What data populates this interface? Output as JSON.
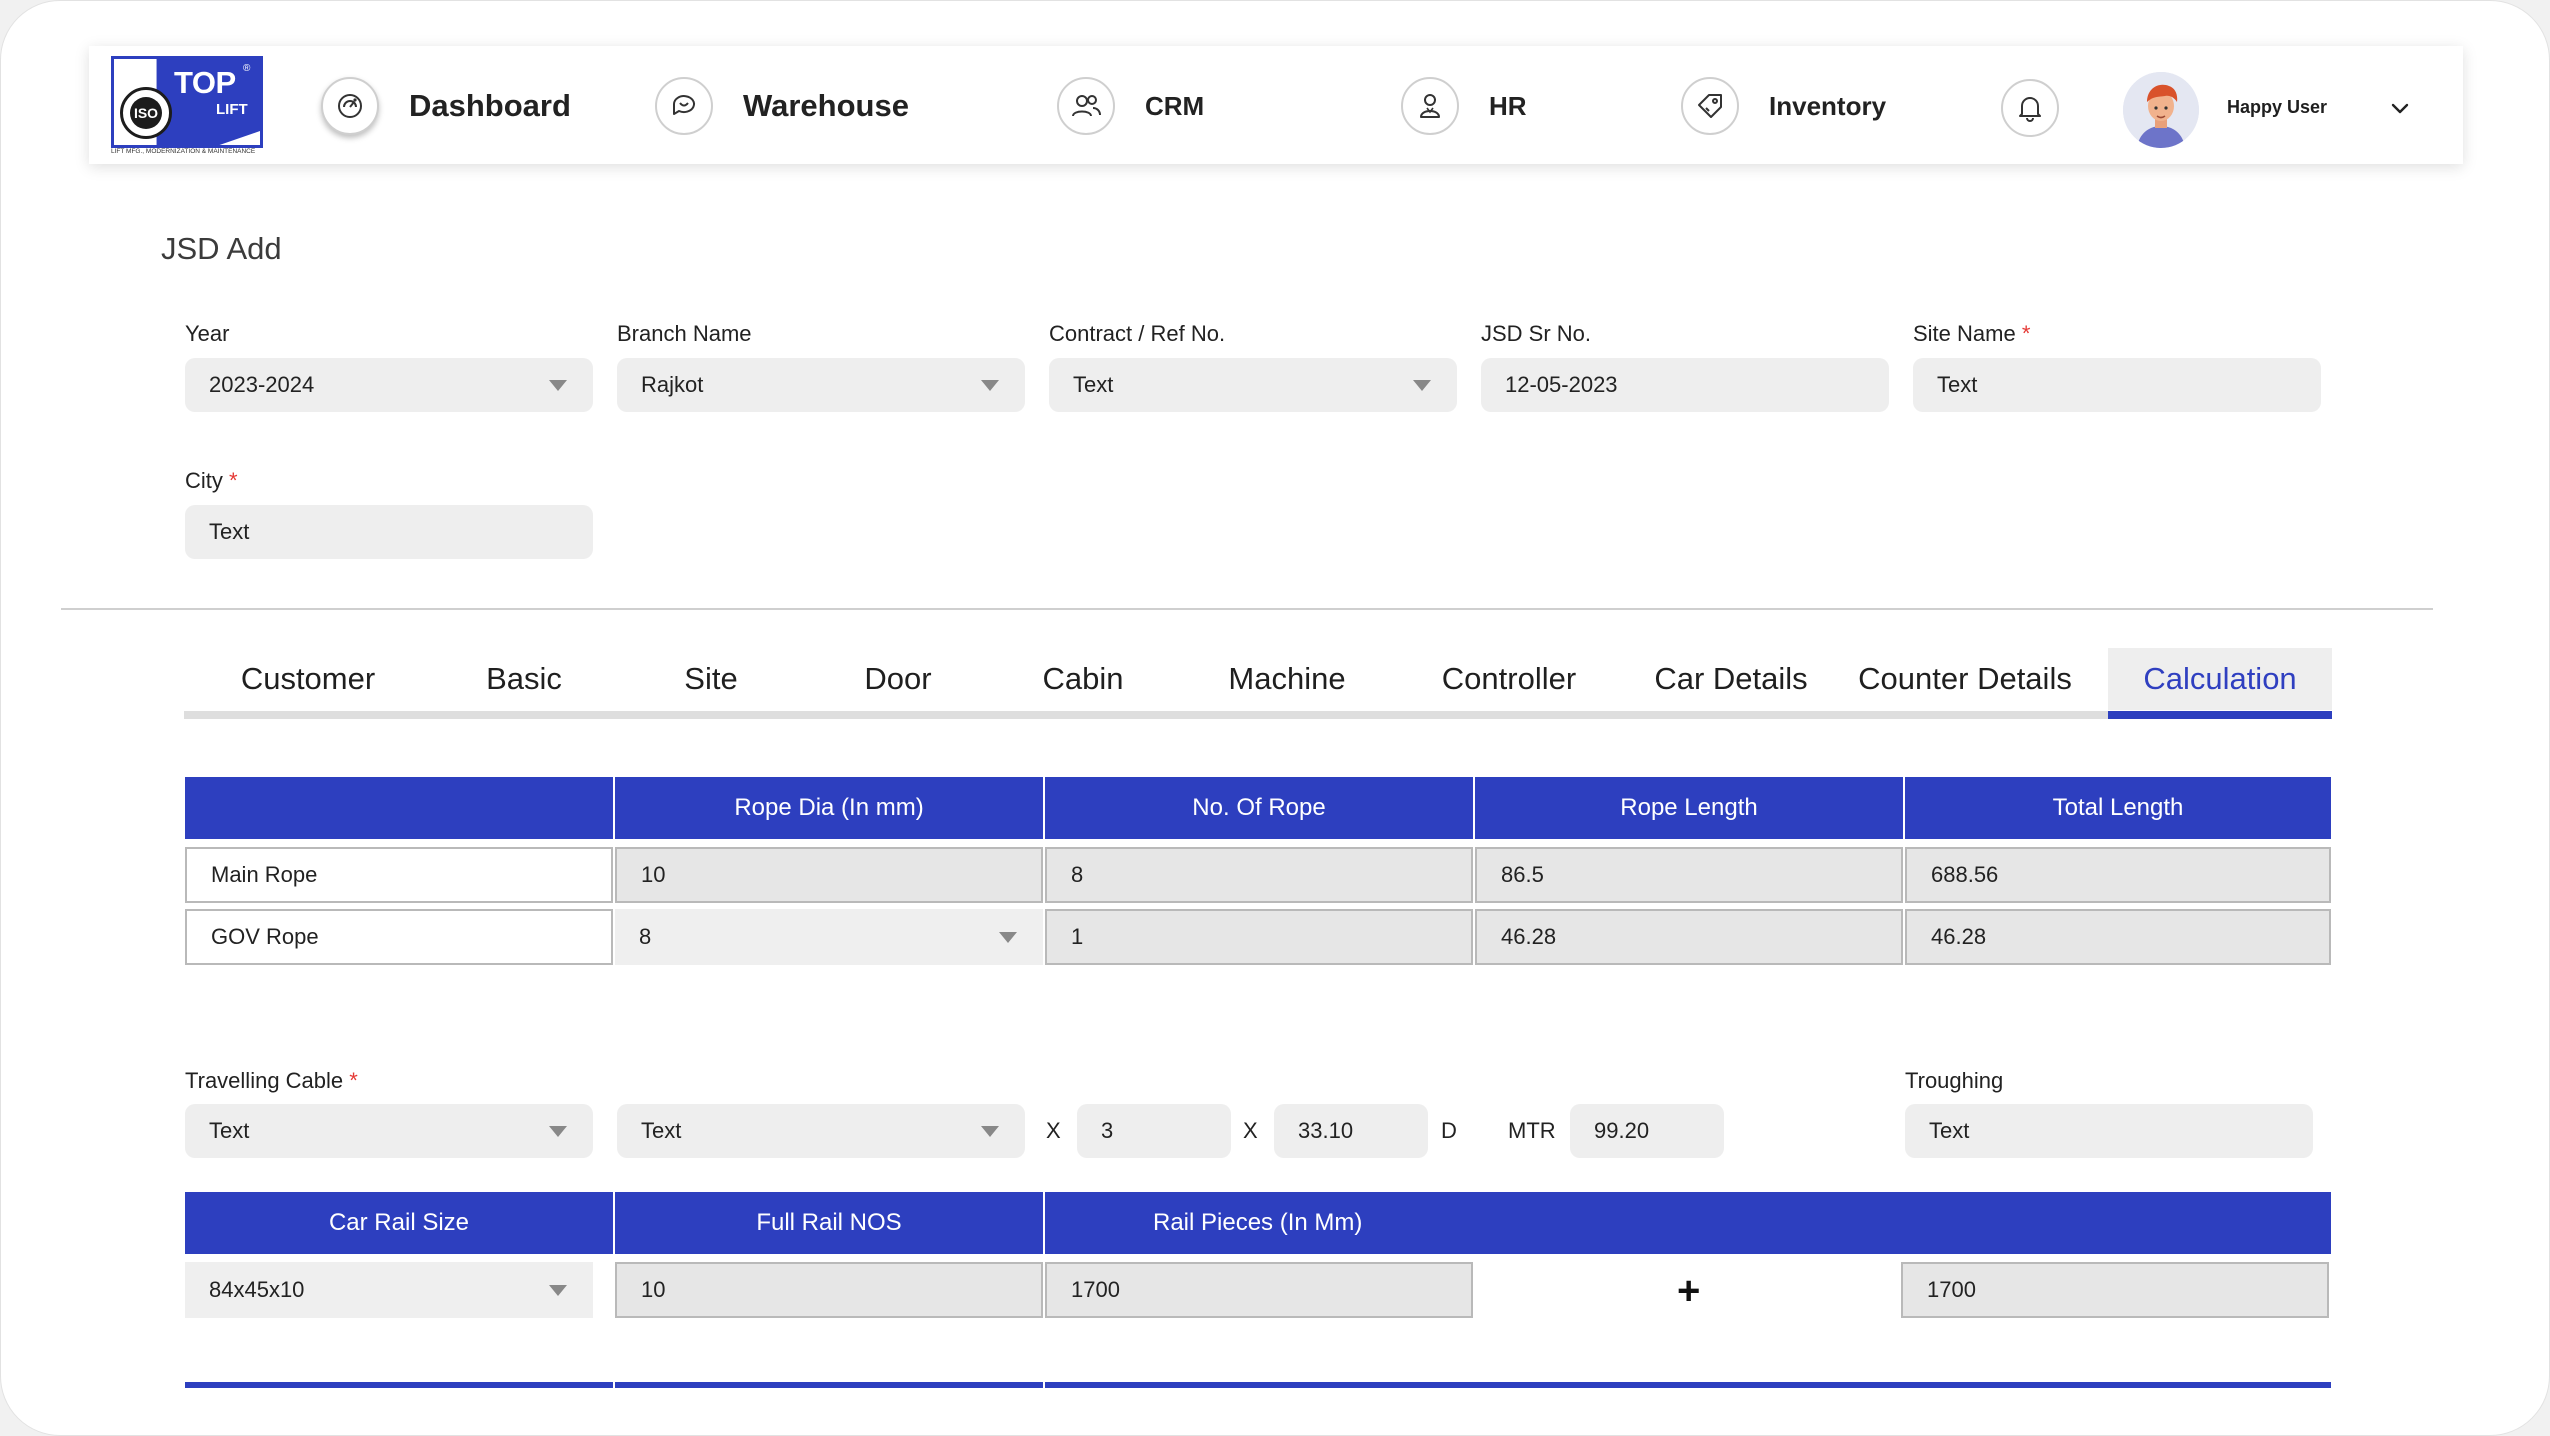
{
  "brand": {
    "logo_top": "TOP",
    "logo_lift": "LIFT",
    "logo_iso": "ISO",
    "logo_tagline": "LIFT MFG., MODERNIZATION & MAINTENANCE",
    "accent_color": "#2d3fbf"
  },
  "nav": {
    "items": [
      {
        "label": "Dashboard",
        "icon": "dashboard-icon"
      },
      {
        "label": "Warehouse",
        "icon": "chat-icon"
      },
      {
        "label": "CRM",
        "icon": "users-icon"
      },
      {
        "label": "HR",
        "icon": "person-icon"
      },
      {
        "label": "Inventory",
        "icon": "tag-icon"
      }
    ],
    "bell_icon": "bell-icon",
    "user_name": "Happy User"
  },
  "page": {
    "title": "JSD Add"
  },
  "form": {
    "year": {
      "label": "Year",
      "value": "2023-2024"
    },
    "branch": {
      "label": "Branch Name",
      "value": "Rajkot"
    },
    "contract": {
      "label": "Contract / Ref No.",
      "value": "Text"
    },
    "jsd_sr": {
      "label": "JSD Sr No.",
      "value": "12-05-2023"
    },
    "site_name": {
      "label": "Site Name",
      "required": "*",
      "value": "Text"
    },
    "city": {
      "label": "City",
      "required": "*",
      "value": "Text"
    }
  },
  "tabs": {
    "items": [
      "Customer",
      "Basic",
      "Site",
      "Door",
      "Cabin",
      "Machine",
      "Controller",
      "Car Details",
      "Counter Details",
      "Calculation"
    ],
    "active": "Calculation"
  },
  "rope_table": {
    "headers": [
      "",
      "Rope Dia (In mm)",
      "No. Of Rope",
      "Rope Length",
      "Total Length"
    ],
    "rows": [
      {
        "name": "Main Rope",
        "dia": "10",
        "count": "8",
        "length": "86.5",
        "total": "688.56"
      },
      {
        "name": "GOV Rope",
        "dia": "8",
        "count": "1",
        "length": "46.28",
        "total": "46.28"
      }
    ]
  },
  "cable": {
    "label": "Travelling Cable",
    "required": "*",
    "select1": "Text",
    "select2": "Text",
    "x1": "X",
    "value1": "3",
    "x2": "X",
    "value2": "33.10",
    "d": "D",
    "mtr_label": "MTR",
    "mtr_value": "99.20",
    "troughing_label": "Troughing",
    "troughing_value": "Text"
  },
  "rail_table": {
    "headers": [
      "Car Rail Size",
      "Full Rail NOS",
      "Rail Pieces (In Mm)"
    ],
    "size": "84x45x10",
    "full_nos": "10",
    "piece1": "1700",
    "plus": "+",
    "piece2": "1700"
  }
}
